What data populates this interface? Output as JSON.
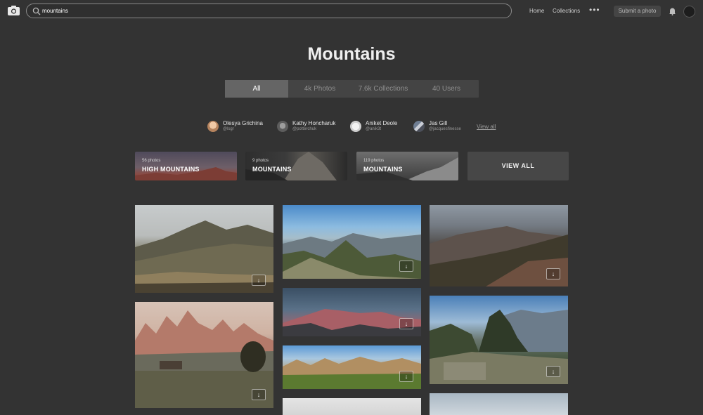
{
  "header": {
    "search": {
      "value": "mountains",
      "placeholder": ""
    },
    "nav": {
      "home": "Home",
      "collections": "Collections",
      "more": "•••"
    },
    "submit_label": "Submit a photo"
  },
  "page": {
    "title": "Mountains"
  },
  "tabs": [
    {
      "label": "All",
      "active": true
    },
    {
      "label": "4k Photos",
      "active": false
    },
    {
      "label": "7.6k Collections",
      "active": false
    },
    {
      "label": "40 Users",
      "active": false
    }
  ],
  "users": [
    {
      "name": "Olesya Grichina",
      "handle": "@lsgr"
    },
    {
      "name": "Kathy Honcharuk",
      "handle": "@potterchuk"
    },
    {
      "name": "Aniket Deole",
      "handle": "@anik3t"
    },
    {
      "name": "Jas Gill",
      "handle": "@jacquesfinesse"
    }
  ],
  "users_view_all": "View all",
  "collections": [
    {
      "count": "56 photos",
      "name": "HIGH MOUNTAINS"
    },
    {
      "count": "9 photos",
      "name": "MOUNTAINS"
    },
    {
      "count": "119 photos",
      "name": "MOUNTAINS"
    }
  ],
  "collections_view_all": "VIEW ALL",
  "download_icon": "↓"
}
